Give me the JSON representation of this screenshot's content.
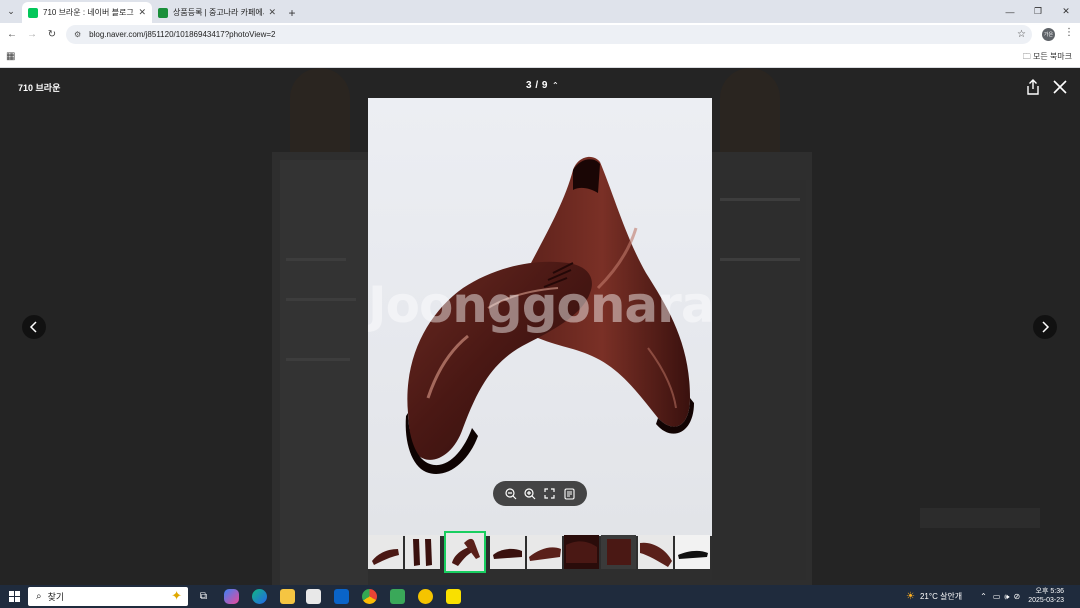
{
  "browser": {
    "tabs": [
      {
        "title": "710 브라운 : 네이버 블로그",
        "active": true,
        "favicon_color": "#03c75a"
      },
      {
        "title": "상품등록 | 중고나라 카페에서",
        "active": false,
        "favicon_color": "#1a8f3a"
      }
    ],
    "url": "blog.naver.com/j851120/10186943417?photoView=2",
    "all_bookmarks_label": "모든 북마크",
    "profile_initials": "가은"
  },
  "viewer": {
    "title": "710 브라운",
    "counter": "3 / 9",
    "watermark": "Joonggonara",
    "thumbnail_count": 9,
    "selected_thumbnail": 3
  },
  "taskbar": {
    "search_placeholder": "찾기",
    "weather": "21°C  살안개",
    "time": "오후 5:36",
    "date": "2025-03-23"
  },
  "colors": {
    "accent_green": "#19ce60",
    "viewer_bg": "#242424",
    "taskbar_bg": "#1f2b3d"
  }
}
